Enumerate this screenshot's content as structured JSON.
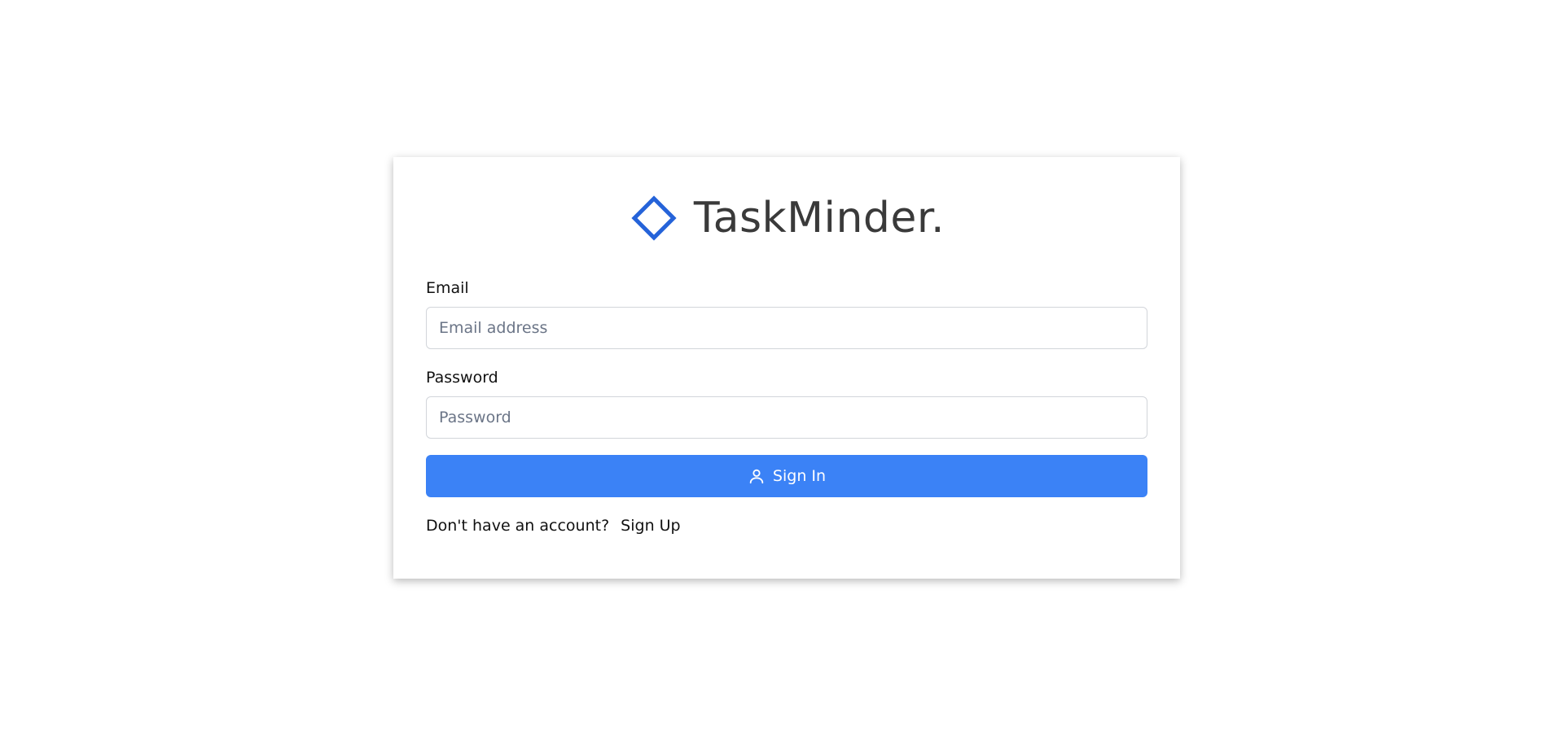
{
  "brand": {
    "name": "TaskMinder.",
    "logo_icon": "diamond-outline-icon",
    "logo_color": "#2563d9"
  },
  "form": {
    "email_label": "Email",
    "email_placeholder": "Email address",
    "email_value": "",
    "password_label": "Password",
    "password_placeholder": "Password",
    "password_value": "",
    "submit_label": "Sign In",
    "submit_icon": "user-icon",
    "submit_color": "#3b82f6"
  },
  "footer": {
    "prompt": "Don't have an account?",
    "signup_link": "Sign Up"
  }
}
